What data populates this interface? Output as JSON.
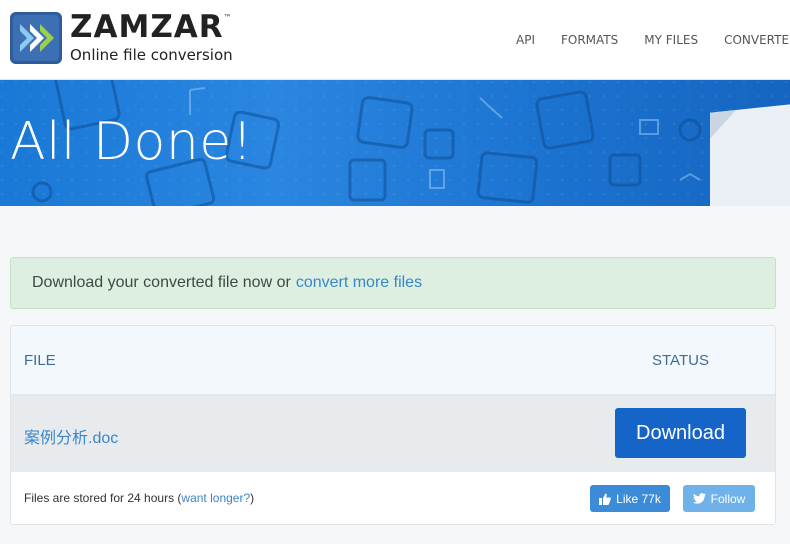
{
  "header": {
    "logo": {
      "name": "ZAMZAR",
      "trademark": "™",
      "tagline": "Online file conversion",
      "icon": "zamzar-chevrons-icon"
    },
    "nav": [
      {
        "label": "API"
      },
      {
        "label": "FORMATS"
      },
      {
        "label": "MY FILES"
      },
      {
        "label": "CONVERTER"
      }
    ]
  },
  "banner": {
    "title": "All Done!"
  },
  "alert": {
    "text": "Download your converted file now or",
    "link": "convert more files"
  },
  "table": {
    "headers": {
      "file": "FILE",
      "status": "STATUS"
    },
    "rows": [
      {
        "file_name": "案例分析.doc",
        "action": "Download"
      }
    ],
    "footer": {
      "text": "Files are stored for 24 hours",
      "open_paren": "(",
      "link": "want longer?",
      "close_paren": ")"
    }
  },
  "social": {
    "like": {
      "label": "Like 77k",
      "icon": "thumbs-up-icon"
    },
    "follow": {
      "label": "Follow",
      "icon": "twitter-bird-icon"
    }
  },
  "colors": {
    "brand_blue": "#2f5c9c",
    "banner_blue": "#1b73cf",
    "download_button": "#1565c8",
    "link": "#3a86c8",
    "alert_bg": "#dcefe0",
    "like_button": "#3b8bd8",
    "follow_button": "#6fb2ea"
  }
}
